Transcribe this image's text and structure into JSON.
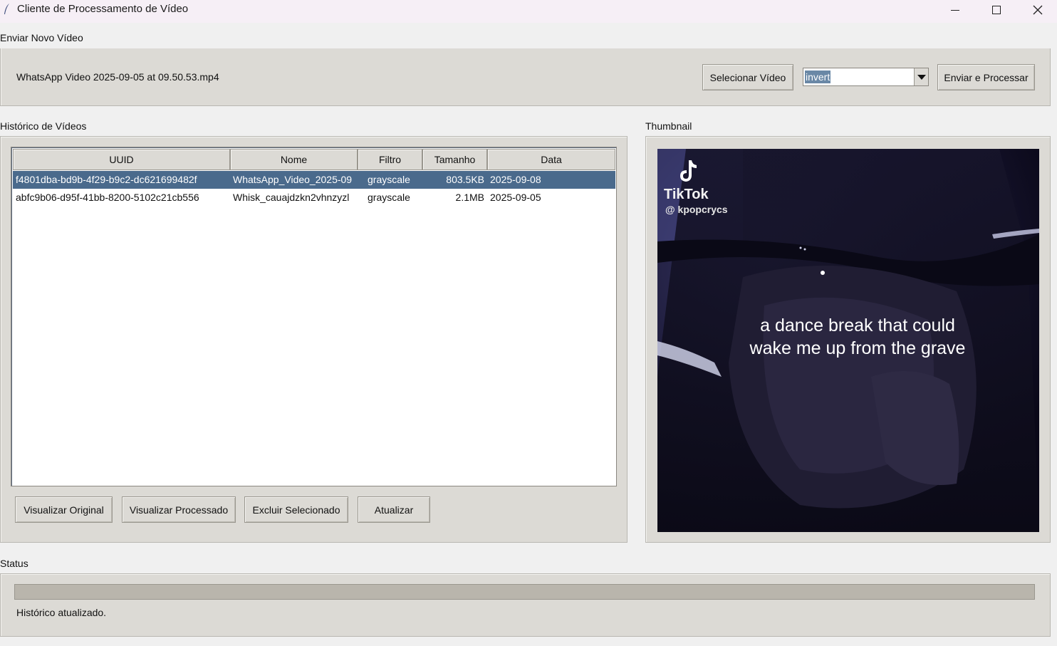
{
  "window": {
    "title": "Cliente de Processamento de Vídeo",
    "minimize_icon": "minimize-icon",
    "maximize_icon": "maximize-icon",
    "close_icon": "close-icon"
  },
  "upload": {
    "frame_label": "Enviar Novo Vídeo",
    "selected_file": "WhatsApp Video 2025-09-05 at 09.50.53.mp4",
    "select_button": "Selecionar Vídeo",
    "filter_value": "invert",
    "submit_button": "Enviar e Processar"
  },
  "history": {
    "frame_label": "Histórico de Vídeos",
    "columns": [
      "UUID",
      "Nome",
      "Filtro",
      "Tamanho",
      "Data"
    ],
    "rows": [
      {
        "uuid": "f4801dba-bd9b-4f29-b9c2-dc621699482f",
        "name": "WhatsApp_Video_2025-09",
        "filter": "grayscale",
        "size": "803.5KB",
        "date": "2025-09-08",
        "selected": true
      },
      {
        "uuid": "abfc9b06-d95f-41bb-8200-5102c21cb556",
        "name": "Whisk_cauajdzkn2vhnzyzl",
        "filter": "grayscale",
        "size": "2.1MB",
        "date": "2025-09-05",
        "selected": false
      }
    ],
    "buttons": {
      "view_original": "Visualizar Original",
      "view_processed": "Visualizar Processado",
      "delete_selected": "Excluir Selecionado",
      "refresh": "Atualizar"
    }
  },
  "thumbnail": {
    "frame_label": "Thumbnail",
    "logo_text": "TikTok",
    "handle": "@ kpopcrycs",
    "caption": "a dance break that could wake me up from the grave"
  },
  "status": {
    "frame_label": "Status",
    "message": "Histórico atualizado.",
    "progress": 0
  },
  "colors": {
    "selection": "#4a6a8c",
    "frame_bg": "#dcdad5",
    "window_bg": "#f0f0f0"
  }
}
